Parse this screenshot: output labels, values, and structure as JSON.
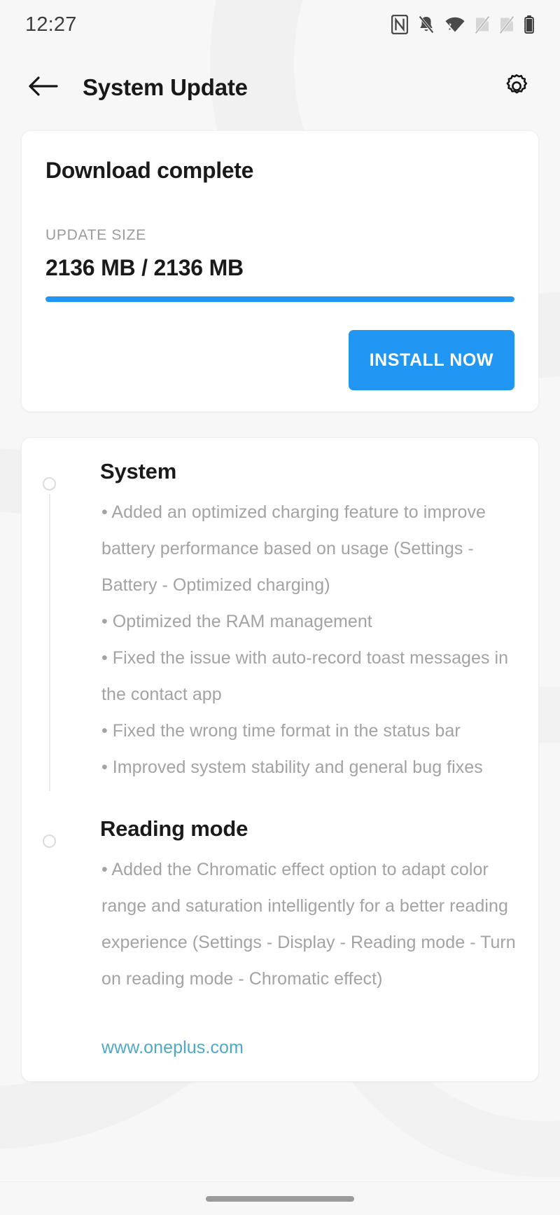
{
  "status_bar": {
    "clock": "12:27",
    "icons": [
      "nfc-icon",
      "bell-muted-icon",
      "wifi-icon",
      "sim-none-1-icon",
      "sim-none-2-icon",
      "battery-icon"
    ]
  },
  "app_bar": {
    "back_icon": "back-arrow-icon",
    "title": "System Update",
    "settings_icon": "gear-icon"
  },
  "download_card": {
    "title": "Download complete",
    "size_label": "UPDATE SIZE",
    "size_value": "2136 MB / 2136 MB",
    "progress_percent": 100,
    "progress_color": "#2196f3",
    "install_button": "INSTALL NOW"
  },
  "changelog": {
    "sections": [
      {
        "heading": "System",
        "items": [
          "• Added an optimized charging feature to improve battery performance based on usage (Settings - Battery - Optimized charging)",
          "• Optimized the RAM management",
          "• Fixed the issue with auto-record toast messages in the contact app",
          "• Fixed the wrong time format in the status bar",
          "• Improved system stability and general bug fixes"
        ]
      },
      {
        "heading": "Reading mode",
        "items": [
          "• Added the Chromatic effect option to adapt color range and saturation intelligently for a better reading experience (Settings - Display - Reading mode - Turn on reading mode - Chromatic effect)"
        ]
      }
    ],
    "link": "www.oneplus.com",
    "link_color": "#4fa8c4"
  },
  "nav_bar": {
    "home_indicator": "home-gesture-pill"
  }
}
